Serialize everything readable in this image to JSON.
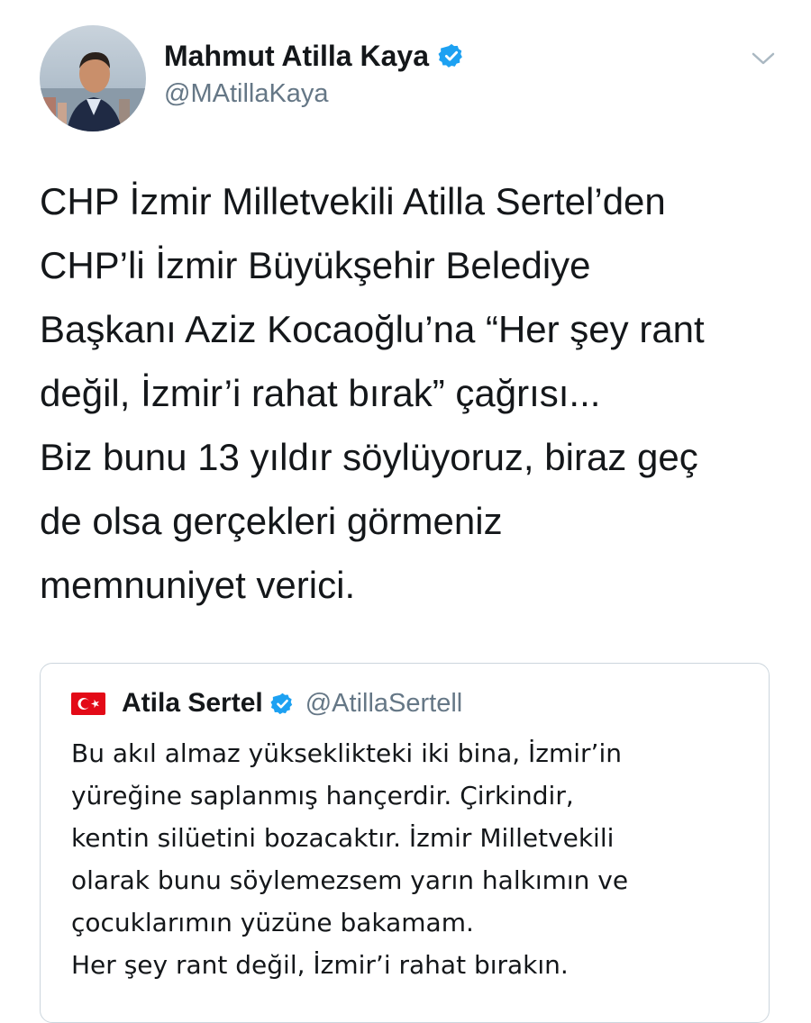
{
  "tweet": {
    "author": {
      "name": "Mahmut Atilla Kaya",
      "handle": "@MAtillaKaya",
      "verified": true,
      "avatar_icon": "profile-photo"
    },
    "menu_icon": "chevron-down-icon",
    "text_lines": [
      "CHP İzmir Milletvekili Atilla Sertel’den",
      "CHP’li İzmir Büyükşehir Belediye",
      "Başkanı Aziz Kocaoğlu’na “Her şey rant",
      "değil, İzmir’i rahat bırak” çağrısı...",
      "Biz bunu 13 yıldır söylüyoruz, biraz geç",
      "de olsa gerçekleri görmeniz",
      "memnuniyet verici."
    ]
  },
  "quoted_tweet": {
    "flag_icon": "turkey-flag-icon",
    "name": "Atila Sertel",
    "handle": "@AtillaSertell",
    "verified": true,
    "text_lines": [
      "Bu akıl almaz yükseklikteki iki bina, İzmir’in",
      "yüreğine saplanmış hançerdir. Çirkindir,",
      "kentin silüetini bozacaktır. İzmir Milletvekili",
      "olarak bunu söylemezsem yarın halkımın ve",
      "çocuklarımın yüzüne bakamam.",
      "Her şey rant değil, İzmir’i rahat bırakın."
    ]
  },
  "colors": {
    "text": "#14171a",
    "secondary_text": "#657786",
    "verified_blue": "#1da1f2",
    "border": "#ccd6dd",
    "flag_red": "#e30a17"
  }
}
